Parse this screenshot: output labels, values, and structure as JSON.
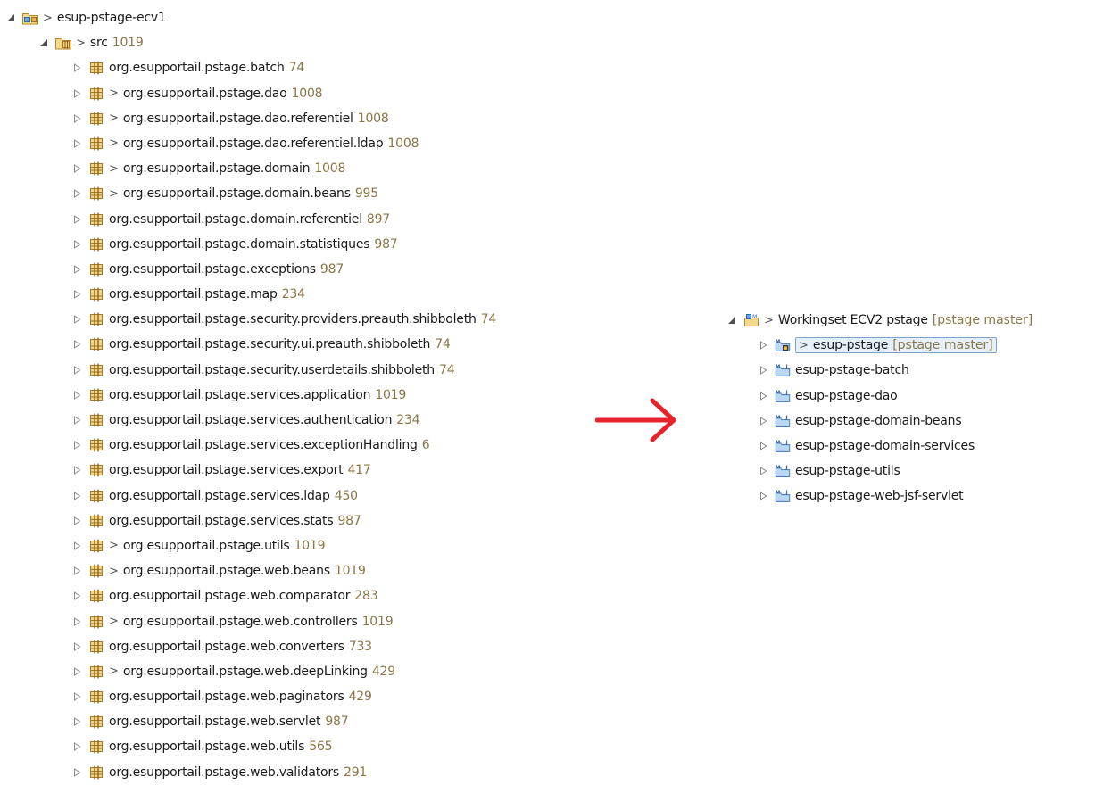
{
  "left_tree": {
    "root": {
      "label": "esup-pstage-ecv1",
      "dirty": ">",
      "expanded": true,
      "icon": "project-icon"
    },
    "src": {
      "label": "src",
      "revision": "1019",
      "dirty": ">",
      "expanded": true,
      "icon": "source-folder-icon"
    },
    "packages": [
      {
        "label": "org.esupportail.pstage.batch",
        "revision": "74",
        "dirty": "",
        "icon": "package-icon"
      },
      {
        "label": "org.esupportail.pstage.dao",
        "revision": "1008",
        "dirty": ">",
        "icon": "package-icon"
      },
      {
        "label": "org.esupportail.pstage.dao.referentiel",
        "revision": "1008",
        "dirty": ">",
        "icon": "package-icon"
      },
      {
        "label": "org.esupportail.pstage.dao.referentiel.ldap",
        "revision": "1008",
        "dirty": ">",
        "icon": "package-icon"
      },
      {
        "label": "org.esupportail.pstage.domain",
        "revision": "1008",
        "dirty": ">",
        "icon": "package-icon"
      },
      {
        "label": "org.esupportail.pstage.domain.beans",
        "revision": "995",
        "dirty": ">",
        "icon": "package-icon"
      },
      {
        "label": "org.esupportail.pstage.domain.referentiel",
        "revision": "897",
        "dirty": "",
        "icon": "package-icon"
      },
      {
        "label": "org.esupportail.pstage.domain.statistiques",
        "revision": "987",
        "dirty": "",
        "icon": "package-icon"
      },
      {
        "label": "org.esupportail.pstage.exceptions",
        "revision": "987",
        "dirty": "",
        "icon": "package-icon"
      },
      {
        "label": "org.esupportail.pstage.map",
        "revision": "234",
        "dirty": "",
        "icon": "package-icon"
      },
      {
        "label": "org.esupportail.pstage.security.providers.preauth.shibboleth",
        "revision": "74",
        "dirty": "",
        "icon": "package-icon"
      },
      {
        "label": "org.esupportail.pstage.security.ui.preauth.shibboleth",
        "revision": "74",
        "dirty": "",
        "icon": "package-icon"
      },
      {
        "label": "org.esupportail.pstage.security.userdetails.shibboleth",
        "revision": "74",
        "dirty": "",
        "icon": "package-icon"
      },
      {
        "label": "org.esupportail.pstage.services.application",
        "revision": "1019",
        "dirty": "",
        "icon": "package-icon"
      },
      {
        "label": "org.esupportail.pstage.services.authentication",
        "revision": "234",
        "dirty": "",
        "icon": "package-icon"
      },
      {
        "label": "org.esupportail.pstage.services.exceptionHandling",
        "revision": "6",
        "dirty": "",
        "icon": "package-icon"
      },
      {
        "label": "org.esupportail.pstage.services.export",
        "revision": "417",
        "dirty": "",
        "icon": "package-icon"
      },
      {
        "label": "org.esupportail.pstage.services.ldap",
        "revision": "450",
        "dirty": "",
        "icon": "package-icon"
      },
      {
        "label": "org.esupportail.pstage.services.stats",
        "revision": "987",
        "dirty": "",
        "icon": "package-icon"
      },
      {
        "label": "org.esupportail.pstage.utils",
        "revision": "1019",
        "dirty": ">",
        "icon": "package-icon"
      },
      {
        "label": "org.esupportail.pstage.web.beans",
        "revision": "1019",
        "dirty": ">",
        "icon": "package-icon"
      },
      {
        "label": "org.esupportail.pstage.web.comparator",
        "revision": "283",
        "dirty": "",
        "icon": "package-icon"
      },
      {
        "label": "org.esupportail.pstage.web.controllers",
        "revision": "1019",
        "dirty": ">",
        "icon": "package-icon"
      },
      {
        "label": "org.esupportail.pstage.web.converters",
        "revision": "733",
        "dirty": "",
        "icon": "package-icon"
      },
      {
        "label": "org.esupportail.pstage.web.deepLinking",
        "revision": "429",
        "dirty": ">",
        "icon": "package-icon"
      },
      {
        "label": "org.esupportail.pstage.web.paginators",
        "revision": "429",
        "dirty": "",
        "icon": "package-icon"
      },
      {
        "label": "org.esupportail.pstage.web.servlet",
        "revision": "987",
        "dirty": "",
        "icon": "package-icon"
      },
      {
        "label": "org.esupportail.pstage.web.utils",
        "revision": "565",
        "dirty": "",
        "icon": "package-icon"
      },
      {
        "label": "org.esupportail.pstage.web.validators",
        "revision": "291",
        "dirty": "",
        "icon": "package-icon"
      }
    ]
  },
  "arrow": {
    "icon": "right-arrow-icon",
    "color": "#e8222b"
  },
  "right_tree": {
    "root": {
      "label": "Workingset ECV2 pstage",
      "branch": "[pstage master]",
      "dirty": ">",
      "expanded": true,
      "icon": "working-set-icon"
    },
    "projects": [
      {
        "label": "esup-pstage",
        "branch": "[pstage master]",
        "dirty": ">",
        "selected": true,
        "icon": "maven-git-project-icon"
      },
      {
        "label": "esup-pstage-batch",
        "branch": "",
        "dirty": "",
        "selected": false,
        "icon": "maven-project-icon"
      },
      {
        "label": "esup-pstage-dao",
        "branch": "",
        "dirty": "",
        "selected": false,
        "icon": "maven-project-icon"
      },
      {
        "label": "esup-pstage-domain-beans",
        "branch": "",
        "dirty": "",
        "selected": false,
        "icon": "maven-project-icon"
      },
      {
        "label": "esup-pstage-domain-services",
        "branch": "",
        "dirty": "",
        "selected": false,
        "icon": "maven-project-icon"
      },
      {
        "label": "esup-pstage-utils",
        "branch": "",
        "dirty": "",
        "selected": false,
        "icon": "maven-project-icon"
      },
      {
        "label": "esup-pstage-web-jsf-servlet",
        "branch": "",
        "dirty": "",
        "selected": false,
        "icon": "maven-project-icon"
      }
    ]
  },
  "colors": {
    "revision_text": "#8b7547",
    "arrow": "#e8222b",
    "package_icon": "#c8a04a"
  }
}
